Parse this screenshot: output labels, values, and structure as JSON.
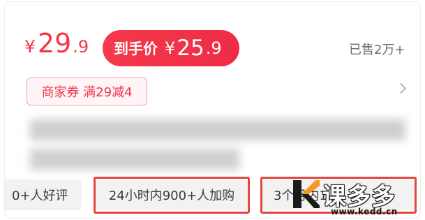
{
  "price": {
    "currency": "¥",
    "integer": "29",
    "decimal": ".9"
  },
  "final_price": {
    "label": "到手价",
    "currency": "¥",
    "integer": "25",
    "decimal": ".9"
  },
  "sales": {
    "text": "已售2万+"
  },
  "coupon": {
    "text": "商家券 满29减4"
  },
  "tags": [
    {
      "text": "0+人好评"
    },
    {
      "text": "24小时内900+人加购"
    },
    {
      "text": "3个月内1"
    }
  ],
  "watermark": {
    "name": "课多多",
    "url": "www.kedd.cn"
  },
  "colors": {
    "accent": "#f4354a",
    "highlight_border": "#e5453f",
    "tag_bg": "#f2f2f2"
  }
}
